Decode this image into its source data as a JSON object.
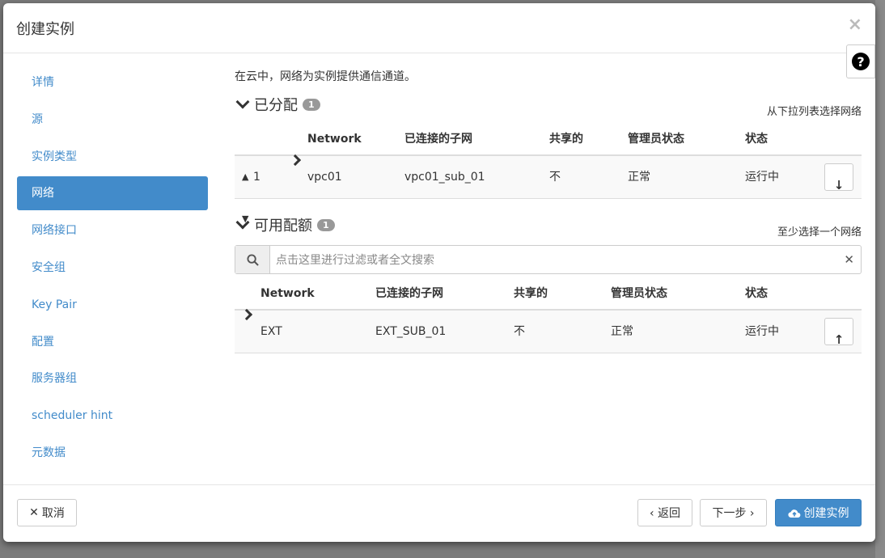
{
  "modal": {
    "title": "创建实例",
    "close_glyph": "×",
    "help_glyph": "?"
  },
  "nav": {
    "items": [
      {
        "label": "详情"
      },
      {
        "label": "源"
      },
      {
        "label": "实例类型"
      },
      {
        "label": "网络",
        "active": true
      },
      {
        "label": "网络接口"
      },
      {
        "label": "安全组"
      },
      {
        "label": "Key Pair"
      },
      {
        "label": "配置"
      },
      {
        "label": "服务器组"
      },
      {
        "label": "scheduler hint"
      },
      {
        "label": "元数据"
      }
    ]
  },
  "intro": "在云中，网络为实例提供通信通道。",
  "allocated": {
    "title": "已分配",
    "count": "1",
    "hint": "从下拉列表选择网络",
    "columns": [
      "Network",
      "已连接的子网",
      "共享的",
      "管理员状态",
      "状态"
    ],
    "rows": [
      {
        "order": "1",
        "network": "vpc01",
        "subnet": "vpc01_sub_01",
        "shared": "不",
        "admin_state": "正常",
        "status": "运行中"
      }
    ]
  },
  "available": {
    "title": "可用配额",
    "count": "1",
    "hint": "至少选择一个网络",
    "search_placeholder": "点击这里进行过滤或者全文搜索",
    "columns": [
      "Network",
      "已连接的子网",
      "共享的",
      "管理员状态",
      "状态"
    ],
    "rows": [
      {
        "network": "EXT",
        "subnet": "EXT_SUB_01",
        "shared": "不",
        "admin_state": "正常",
        "status": "运行中"
      }
    ]
  },
  "footer": {
    "cancel": "取消",
    "back": "‹ 返回",
    "next": "下一步 ›",
    "create": "创建实例"
  },
  "colors": {
    "primary": "#428bca",
    "link": "#428bca"
  }
}
